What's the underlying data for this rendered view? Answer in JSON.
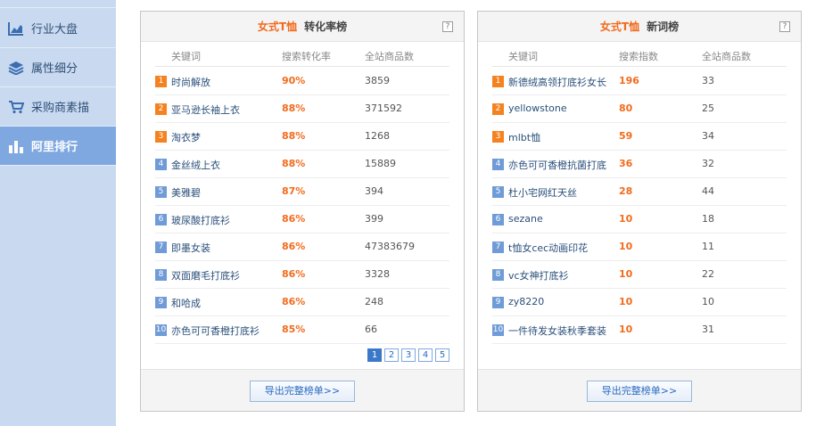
{
  "sidebar": {
    "items": [
      {
        "label": "行业大盘",
        "icon": "area-chart-icon"
      },
      {
        "label": "属性细分",
        "icon": "layers-icon"
      },
      {
        "label": "采购商素描",
        "icon": "cart-icon"
      },
      {
        "label": "阿里排行",
        "icon": "bar-chart-icon",
        "active": true
      }
    ]
  },
  "left_panel": {
    "category": "女式T恤",
    "title": "转化率榜",
    "help": "?",
    "columns": [
      "关键词",
      "搜索转化率",
      "全站商品数"
    ],
    "rows": [
      {
        "rank": "1",
        "keyword": "时尚解放",
        "value": "90%",
        "count": "3859"
      },
      {
        "rank": "2",
        "keyword": "亚马逊长袖上衣",
        "value": "88%",
        "count": "371592"
      },
      {
        "rank": "3",
        "keyword": "淘衣梦",
        "value": "88%",
        "count": "1268"
      },
      {
        "rank": "4",
        "keyword": "金丝绒上衣",
        "value": "88%",
        "count": "15889"
      },
      {
        "rank": "5",
        "keyword": "美雅碧",
        "value": "87%",
        "count": "394"
      },
      {
        "rank": "6",
        "keyword": "玻尿酸打底衫",
        "value": "86%",
        "count": "399"
      },
      {
        "rank": "7",
        "keyword": "即墨女装",
        "value": "86%",
        "count": "47383679"
      },
      {
        "rank": "8",
        "keyword": "双面磨毛打底衫",
        "value": "86%",
        "count": "3328"
      },
      {
        "rank": "9",
        "keyword": "和哈成",
        "value": "86%",
        "count": "248"
      },
      {
        "rank": "10",
        "keyword": "亦色可可香橙打底衫",
        "value": "85%",
        "count": "66"
      }
    ],
    "pages": [
      "1",
      "2",
      "3",
      "4",
      "5"
    ],
    "current_page": "1",
    "export_label": "导出完整榜单>>"
  },
  "right_panel": {
    "category": "女式T恤",
    "title": "新词榜",
    "help": "?",
    "columns": [
      "关键词",
      "搜索指数",
      "全站商品数"
    ],
    "rows": [
      {
        "rank": "1",
        "keyword": "新德绒高领打底衫女长",
        "value": "196",
        "count": "33"
      },
      {
        "rank": "2",
        "keyword": "yellowstone",
        "value": "80",
        "count": "25"
      },
      {
        "rank": "3",
        "keyword": "mlbt恤",
        "value": "59",
        "count": "34"
      },
      {
        "rank": "4",
        "keyword": "亦色可可香橙抗菌打底",
        "value": "36",
        "count": "32"
      },
      {
        "rank": "5",
        "keyword": "杜小宅网红天丝",
        "value": "28",
        "count": "44"
      },
      {
        "rank": "6",
        "keyword": "sezane",
        "value": "10",
        "count": "18"
      },
      {
        "rank": "7",
        "keyword": "t恤女cec动画印花",
        "value": "10",
        "count": "11"
      },
      {
        "rank": "8",
        "keyword": "vc女神打底衫",
        "value": "10",
        "count": "22"
      },
      {
        "rank": "9",
        "keyword": "zy8220",
        "value": "10",
        "count": "10"
      },
      {
        "rank": "10",
        "keyword": "一件待发女装秋季套装",
        "value": "10",
        "count": "31"
      }
    ],
    "export_label": "导出完整榜单>>"
  },
  "colors": {
    "accent_orange": "#f26b1d",
    "rank_top3": "#f58220",
    "rank_rest": "#6f9bd6",
    "nav_active": "#7fa8e0",
    "sidebar_bg": "#c9daf0"
  }
}
